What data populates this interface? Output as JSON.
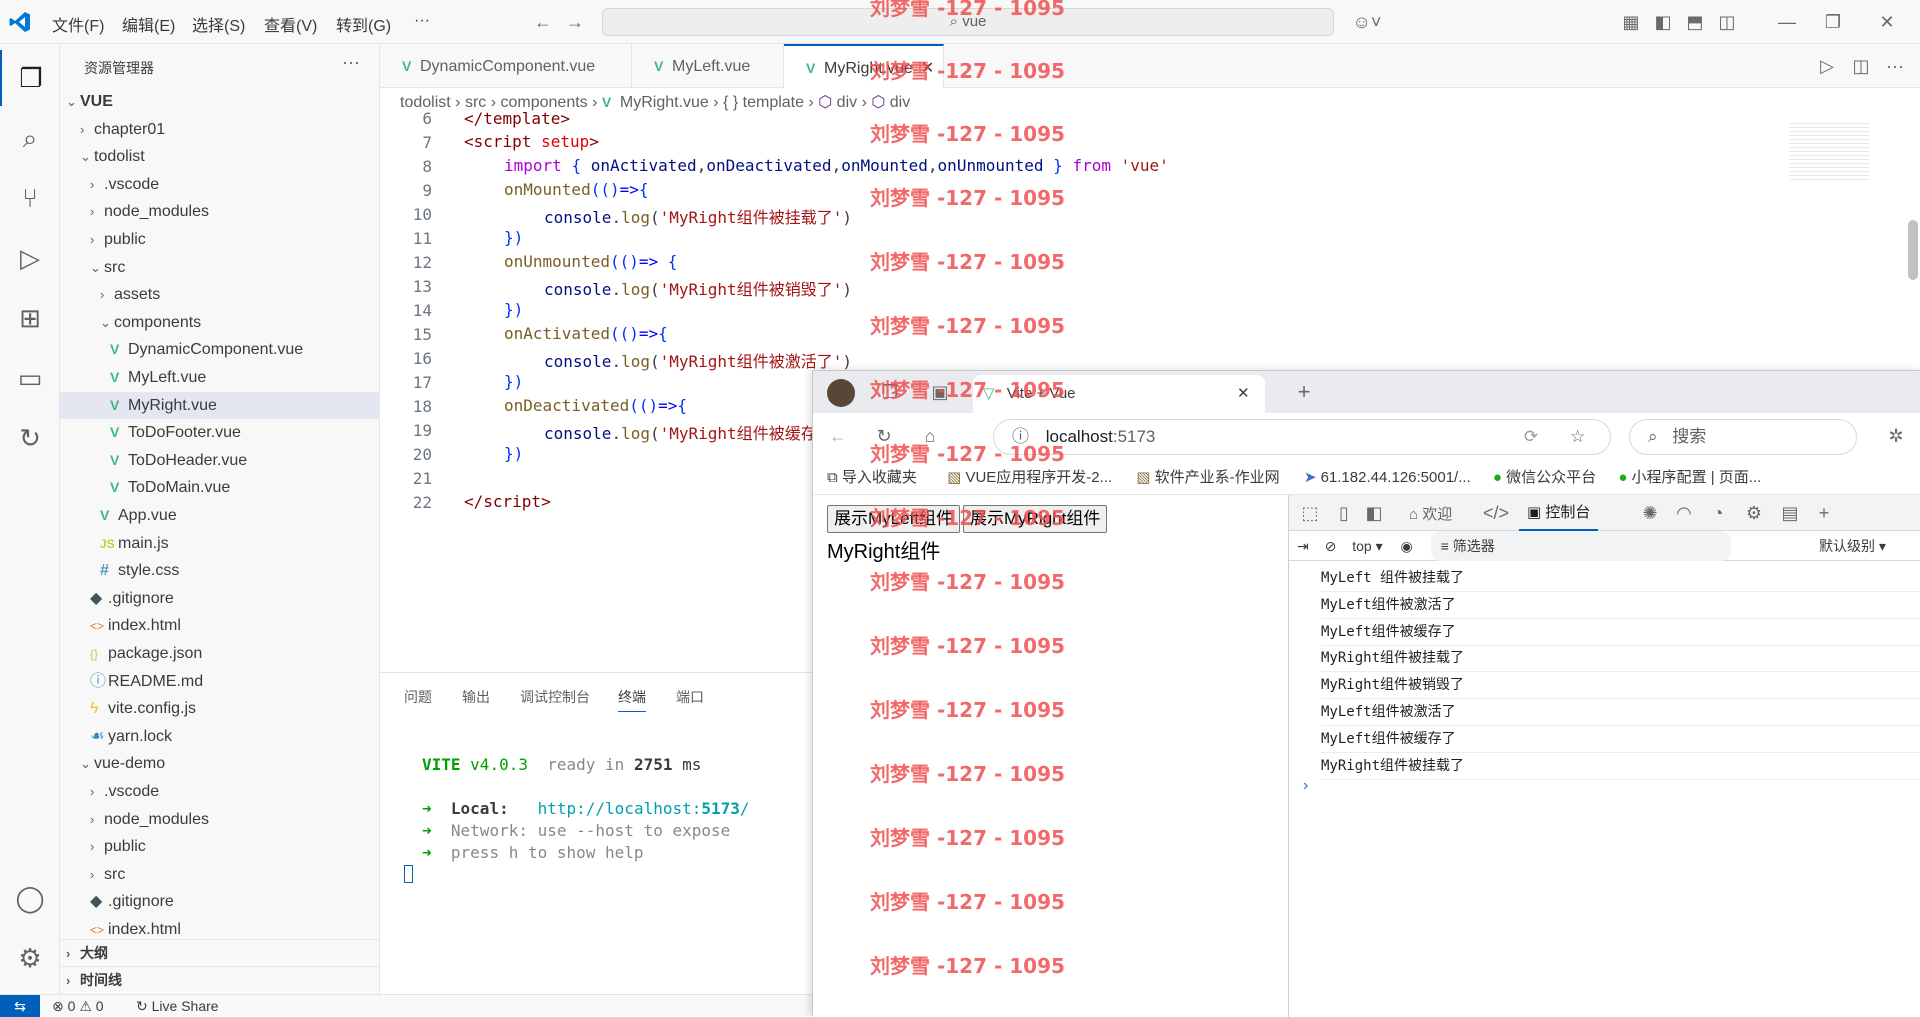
{
  "titlebar": {
    "menus": [
      "文件(F)",
      "编辑(E)",
      "选择(S)",
      "查看(V)",
      "转到(G)",
      "···"
    ],
    "search": "vue"
  },
  "sidebar": {
    "title": "资源管理器",
    "items": [
      {
        "label": "VUE",
        "indent": 0,
        "type": "root"
      },
      {
        "label": "chapter01",
        "indent": 1,
        "type": "folder-closed"
      },
      {
        "label": "todolist",
        "indent": 1,
        "type": "folder-open"
      },
      {
        "label": ".vscode",
        "indent": 2,
        "type": "folder-closed"
      },
      {
        "label": "node_modules",
        "indent": 2,
        "type": "folder-closed"
      },
      {
        "label": "public",
        "indent": 2,
        "type": "folder-closed"
      },
      {
        "label": "src",
        "indent": 2,
        "type": "folder-open"
      },
      {
        "label": "assets",
        "indent": 3,
        "type": "folder-closed"
      },
      {
        "label": "components",
        "indent": 3,
        "type": "folder-open"
      },
      {
        "label": "DynamicComponent.vue",
        "indent": 4,
        "type": "vue"
      },
      {
        "label": "MyLeft.vue",
        "indent": 4,
        "type": "vue"
      },
      {
        "label": "MyRight.vue",
        "indent": 4,
        "type": "vue",
        "selected": true
      },
      {
        "label": "ToDoFooter.vue",
        "indent": 4,
        "type": "vue"
      },
      {
        "label": "ToDoHeader.vue",
        "indent": 4,
        "type": "vue"
      },
      {
        "label": "ToDoMain.vue",
        "indent": 4,
        "type": "vue"
      },
      {
        "label": "App.vue",
        "indent": 3,
        "type": "vue"
      },
      {
        "label": "main.js",
        "indent": 3,
        "type": "js"
      },
      {
        "label": "style.css",
        "indent": 3,
        "type": "css"
      },
      {
        "label": ".gitignore",
        "indent": 2,
        "type": "git"
      },
      {
        "label": "index.html",
        "indent": 2,
        "type": "html"
      },
      {
        "label": "package.json",
        "indent": 2,
        "type": "json"
      },
      {
        "label": "README.md",
        "indent": 2,
        "type": "info"
      },
      {
        "label": "vite.config.js",
        "indent": 2,
        "type": "bolt"
      },
      {
        "label": "yarn.lock",
        "indent": 2,
        "type": "yarn"
      },
      {
        "label": "vue-demo",
        "indent": 1,
        "type": "folder-open"
      },
      {
        "label": ".vscode",
        "indent": 2,
        "type": "folder-closed"
      },
      {
        "label": "node_modules",
        "indent": 2,
        "type": "folder-closed"
      },
      {
        "label": "public",
        "indent": 2,
        "type": "folder-closed"
      },
      {
        "label": "src",
        "indent": 2,
        "type": "folder-closed"
      },
      {
        "label": ".gitignore",
        "indent": 2,
        "type": "git"
      },
      {
        "label": "index.html",
        "indent": 2,
        "type": "html"
      }
    ],
    "outline": "大纲",
    "timeline": "时间线"
  },
  "editor": {
    "tabs": [
      "DynamicComponent.vue",
      "MyLeft.vue",
      "MyRight.vue"
    ],
    "breadcrumb": [
      "todolist",
      "src",
      "components",
      "MyRight.vue",
      "{ } template",
      "div",
      "div"
    ],
    "line_numbers": [
      "6",
      "7",
      "8",
      "9",
      "10",
      "11",
      "12",
      "13",
      "14",
      "15",
      "16",
      "17",
      "18",
      "19",
      "20",
      "21",
      "22"
    ]
  },
  "panel": {
    "tabs": [
      "问题",
      "输出",
      "调试控制台",
      "终端",
      "端口"
    ],
    "vite": "VITE",
    "version": "v4.0.3",
    "ready": "ready in",
    "ms_value": "2751",
    "ms": "ms",
    "local_label": "Local:",
    "local_url": "http://localhost:",
    "local_port": "5173",
    "network_line": "Network: use --host to expose",
    "help_line": "press h to show help"
  },
  "statusbar": {
    "errors": "0",
    "warnings": "0",
    "liveshare": "Live Share"
  },
  "browser": {
    "tab_title": "Vite + Vue",
    "url_host": "localhost",
    "url_port": ":5173",
    "search_placeholder": "搜索",
    "favorites": [
      "导入收藏夹",
      "VUE应用程序开发-2...",
      "软件产业系-作业网",
      "61.182.44.126:5001/...",
      "微信公众平台",
      "小程序配置 | 页面..."
    ],
    "page_buttons": [
      "展示MyLeft组件",
      "展示MyRight组件"
    ],
    "page_heading": "MyRight组件",
    "devtools": {
      "welcome": "欢迎",
      "console": "控制台",
      "context": "top",
      "filter": "筛选器",
      "level": "默认级别",
      "logs": [
        "MyLeft 组件被挂载了",
        "MyLeft组件被激活了",
        "MyLeft组件被缓存了",
        "MyRight组件被挂载了",
        "MyRight组件被销毁了",
        "MyLeft组件被激活了",
        "MyLeft组件被缓存了",
        "MyRight组件被挂载了"
      ]
    }
  },
  "watermark": "刘梦雪 -127 - 1095",
  "colors": {
    "accent": "#005fb8",
    "vue_green": "#41b883",
    "watermark": "#f04f4f"
  }
}
